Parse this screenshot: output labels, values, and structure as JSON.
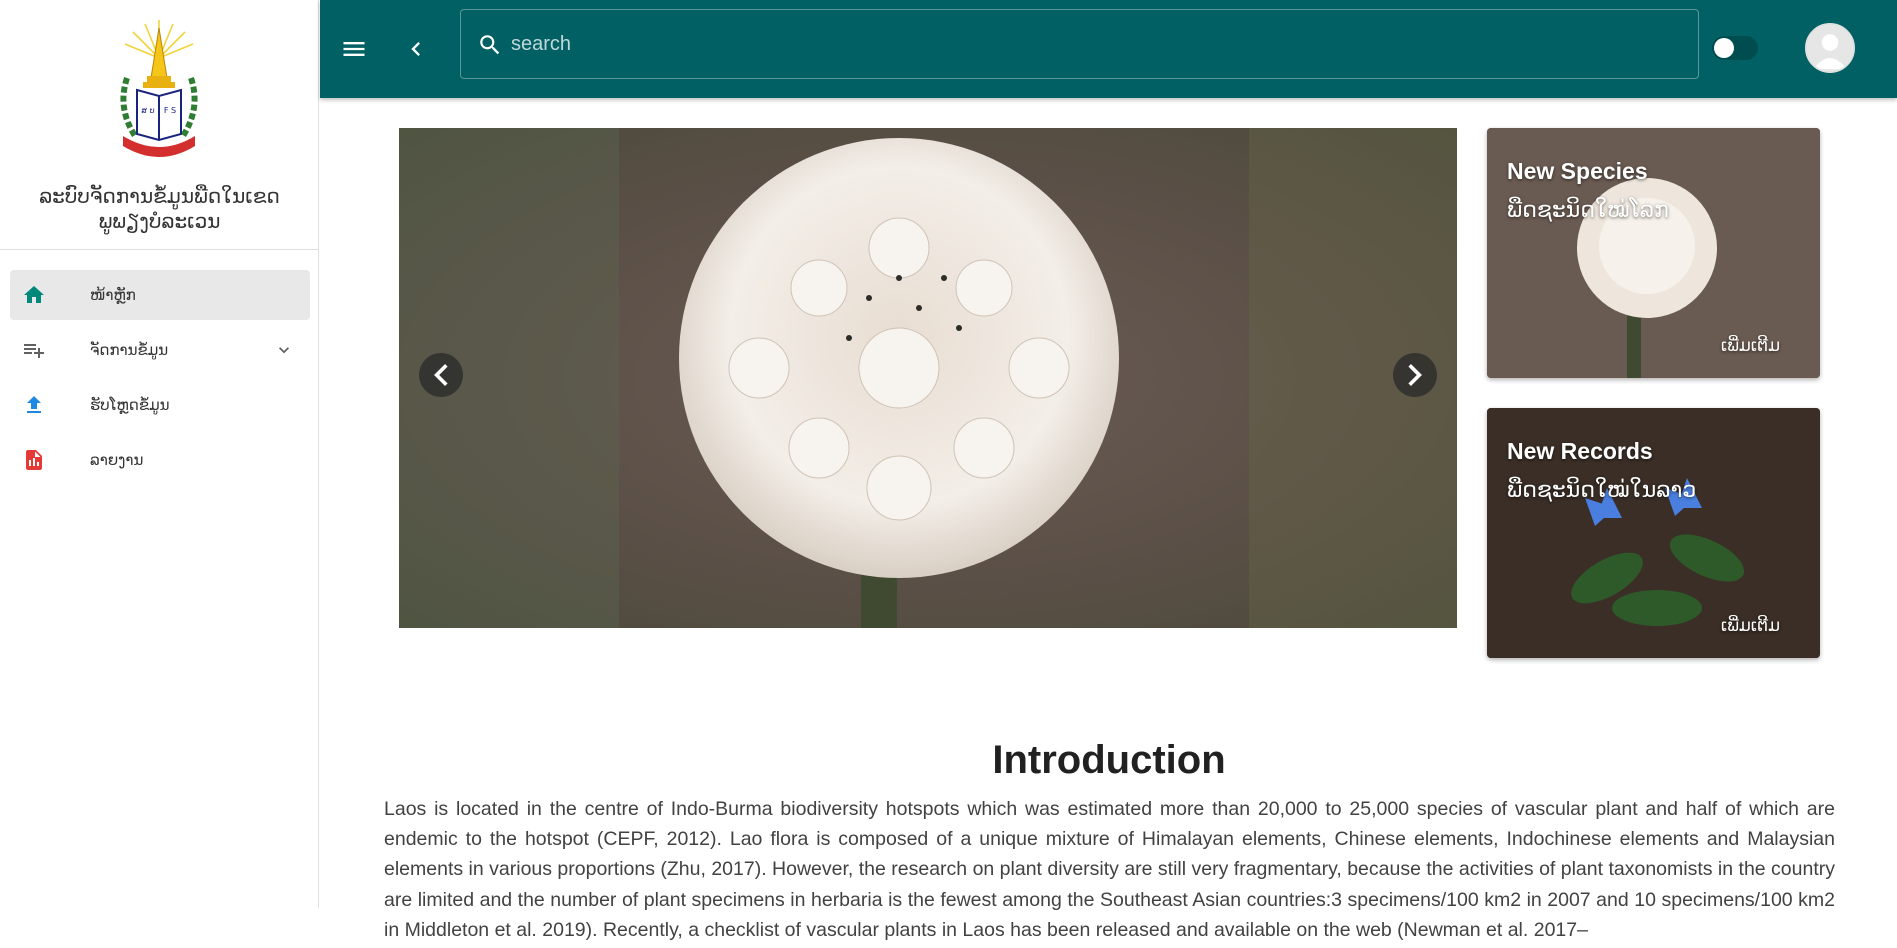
{
  "sidebar": {
    "title_line1": "ລະບົບຈັດການຂໍ້ມູນພືດໃນເຂດ",
    "title_line2": "ພູພຽງບໍລະເວນ",
    "items": [
      {
        "label": "ໜ້າຫຼັກ",
        "icon": "home-icon",
        "active": true
      },
      {
        "label": "ຈັດການຂໍ້ມູນ",
        "icon": "playlist-add-icon",
        "expandable": true
      },
      {
        "label": "ຮັບໂຫຼດຂໍ້ມູນ",
        "icon": "upload-icon"
      },
      {
        "label": "ລາຍງານ",
        "icon": "report-icon"
      }
    ]
  },
  "header": {
    "search_placeholder": "search",
    "bar_color": "#006064"
  },
  "cards": {
    "new_species": {
      "title": "New Species",
      "subtitle": "ພືດຊະນິດໃໝ່ໂລກ",
      "more": "ເພີ່ມເຕີມ"
    },
    "new_records": {
      "title": "New Records",
      "subtitle": "ພືດຊະນິດໃໝ່ໃນລາວ",
      "more": "ເພີ່ມເຕີມ"
    }
  },
  "intro": {
    "title": "Introduction",
    "text": "Laos is located in the centre of Indo-Burma biodiversity hotspots which was estimated more than 20,000 to 25,000 species of vascular plant and half of which are endemic to the hotspot (CEPF, 2012). Lao flora is composed of a unique mixture of Himalayan elements, Chinese elements, Indochinese elements and Malaysian elements in various proportions (Zhu, 2017). However, the research on plant diversity are still very fragmentary, because the activities of plant taxonomists in the country are limited and the number of plant specimens in herbaria is the fewest among the Southeast Asian countries:3 specimens/100 km2 in 2007 and 10 specimens/100 km2 in Middleton et al. 2019). Recently, a checklist of vascular plants in Laos has been released and available on the web (Newman et al. 2017–"
  }
}
